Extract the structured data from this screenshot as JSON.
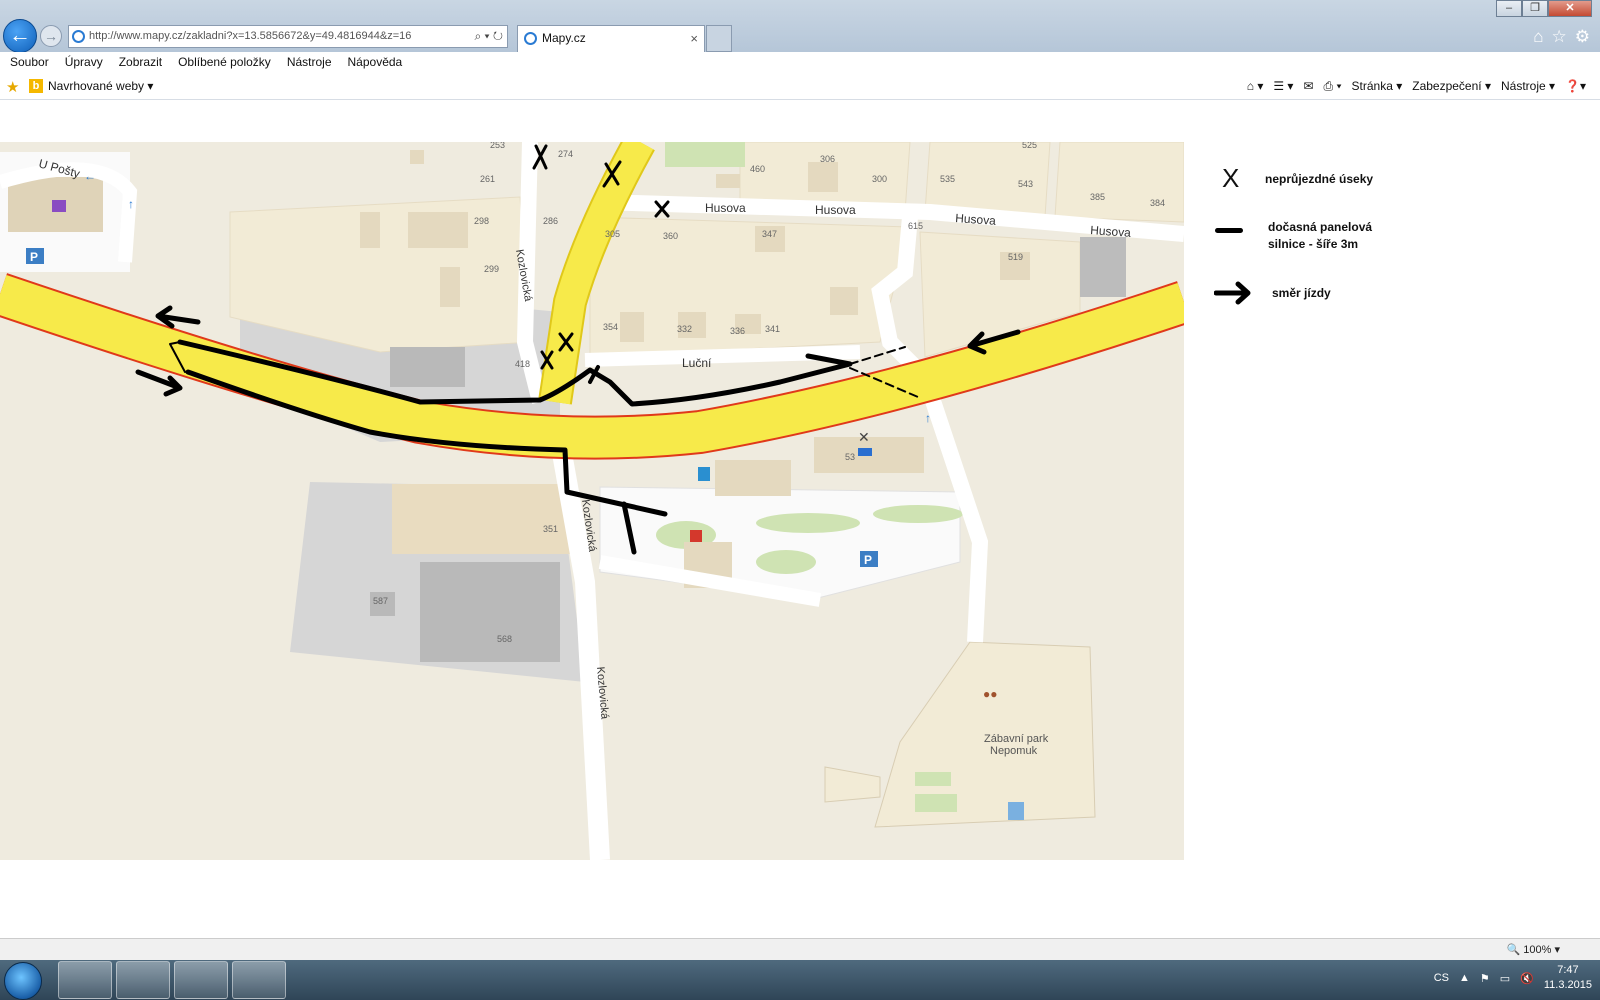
{
  "browser": {
    "address_url": "http://www.mapy.cz/zakladni?x=13.5856672&y=49.4816944&z=16",
    "tab_title": "Mapy.cz",
    "tab_close": "×",
    "menu": [
      "Soubor",
      "Úpravy",
      "Zobrazit",
      "Oblíbené položky",
      "Nástroje",
      "Nápověda"
    ],
    "favorites_suggested": "Navrhované weby ▾",
    "command_bar": [
      "Stránka ▾",
      "Zabezpečení ▾",
      "Nástroje ▾"
    ],
    "status_zoom": "100%"
  },
  "map": {
    "streets": {
      "u_posty": "U Pošty",
      "husova_1": "Husova",
      "husova_2": "Husova",
      "husova_3": "Husova",
      "husova_4": "Husova",
      "kozlovicka_1": "Kozlovická",
      "kozlovicka_2": "Kozlovická",
      "kozlovicka_3": "Kozlovická",
      "lucni": "Luční"
    },
    "house_numbers": {
      "n253": "253",
      "n274": "274",
      "n306": "306",
      "n525": "525",
      "n261": "261",
      "n460": "460",
      "n300": "300",
      "n535": "535",
      "n543": "543",
      "n385": "385",
      "n384": "384",
      "n298": "298",
      "n286": "286",
      "n305": "305",
      "n360": "360",
      "n347": "347",
      "n615": "615",
      "n519": "519",
      "n299": "299",
      "n354": "354",
      "n332": "332",
      "n336": "336",
      "n341": "341",
      "n418": "418",
      "n53": "53",
      "n351": "351",
      "n587": "587",
      "n568": "568"
    },
    "poi_park_line1": "Zábavní park",
    "poi_park_line2": "Nepomuk",
    "parking_label": "P"
  },
  "legend": {
    "closed_symbol": "X",
    "closed_label": "neprůjezdné úseky",
    "temp_road_label_1": "dočasná panelová",
    "temp_road_label_2": "silnice - šíře 3m",
    "direction_label": "směr jízdy"
  },
  "taskbar": {
    "lang": "CS",
    "time": "7:47",
    "date": "11.3.2015"
  },
  "colors": {
    "main_road": "#f7ea4a",
    "road_border": "#e0391a",
    "land": "#efebdf",
    "building": "#dfd3b8",
    "industrial": "#d4d4d4",
    "green": "#cfe3b3"
  }
}
